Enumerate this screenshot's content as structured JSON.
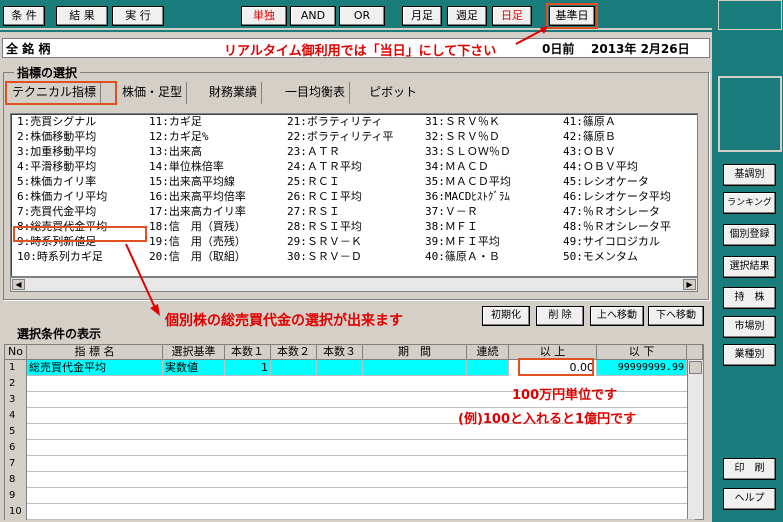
{
  "toolbar": {
    "condition": "条 件",
    "result": "結 果",
    "run": "実 行",
    "single": "単独",
    "and": "AND",
    "or": "OR",
    "monthly": "月足",
    "weekly": "週足",
    "daily": "日足",
    "base_date": "基準日"
  },
  "header": {
    "all_stocks": "全 銘 柄",
    "notice": "リアルタイム御利用では「当日」にして下さい",
    "days_before": "0日前",
    "date": "2013年 2月26日"
  },
  "indicator_section": {
    "title": "指標の選択",
    "tabs": [
      "テクニカル指標",
      "株価・足型",
      "財務業績",
      "一目均衡表",
      "ピボット"
    ],
    "columns": [
      [
        "1:売買シグナル",
        "2:株価移動平均",
        "3:加重移動平均",
        "4:平滑移動平均",
        "5:株価カイリ率",
        "6:株価カイリ平均",
        "7:売買代金平均",
        "8:総売買代金平均",
        "9:時系列新値足",
        "10:時系列カギ足"
      ],
      [
        "11:カギ足",
        "12:カギ足%",
        "13:出来高",
        "14:単位株倍率",
        "15:出来高平均線",
        "16:出来高平均倍率",
        "17:出来高カイリ率",
        "18:信　用（買残）",
        "19:信　用（売残）",
        "20:信　用（取組）"
      ],
      [
        "21:ボラティリティ",
        "22:ボラティリティ平",
        "23:ＡＴＲ",
        "24:ＡＴＲ平均",
        "25:ＲＣＩ",
        "26:ＲＣＩ平均",
        "27:ＲＳＩ",
        "28:ＲＳＩ平均",
        "29:ＳＲＶ－Ｋ",
        "30:ＳＲＶ－Ｄ"
      ],
      [
        "31:ＳＲＶ％Ｋ",
        "32:ＳＲＶ％Ｄ",
        "33:ＳＬＯＷ％Ｄ",
        "34:ＭＡＣＤ",
        "35:ＭＡＣＤ平均",
        "36:MACDﾋｽﾄｸﾞﾗﾑ",
        "37:Ｖ－Ｒ",
        "38:ＭＦＩ",
        "39:ＭＦＩ平均",
        "40:篠原Ａ・Ｂ"
      ],
      [
        "41:篠原Ａ",
        "42:篠原Ｂ",
        "43:ＯＢＶ",
        "44:ＯＢＶ平均",
        "45:レシオケータ",
        "46:レシオケータ平均",
        "47:％Ｒオシレータ",
        "48:％Ｒオシレータ平",
        "49:サイコロジカル",
        "50:モメンタム"
      ]
    ]
  },
  "list_buttons": {
    "init": "初期化",
    "delete": "削 除",
    "move_up": "上へ移動",
    "move_down": "下へ移動"
  },
  "condition_section": {
    "title": "選択条件の表示",
    "headers": [
      "No",
      "指 標 名",
      "選択基準",
      "本数１",
      "本数２",
      "本数３",
      "期　間",
      "連続",
      "以 上",
      "以 下"
    ],
    "row1": {
      "no": "1",
      "name": "総売買代金平均",
      "criteria": "実数値",
      "count1": "1",
      "min": "0.00",
      "max": "99999999.99"
    },
    "row_numbers": [
      "2",
      "3",
      "4",
      "5",
      "6",
      "7",
      "8",
      "9",
      "10"
    ]
  },
  "annotations": {
    "total_volume": "個別株の総売買代金の選択が出来ます",
    "unit": "100万円単位です",
    "example": "(例)100と入れると1億円です"
  },
  "right_panel": {
    "buttons": [
      "基調別",
      "ランキング",
      "個別登録",
      "選択結果",
      "持　株",
      "市場別",
      "業種別"
    ],
    "print": "印　刷",
    "help": "ヘルプ"
  }
}
